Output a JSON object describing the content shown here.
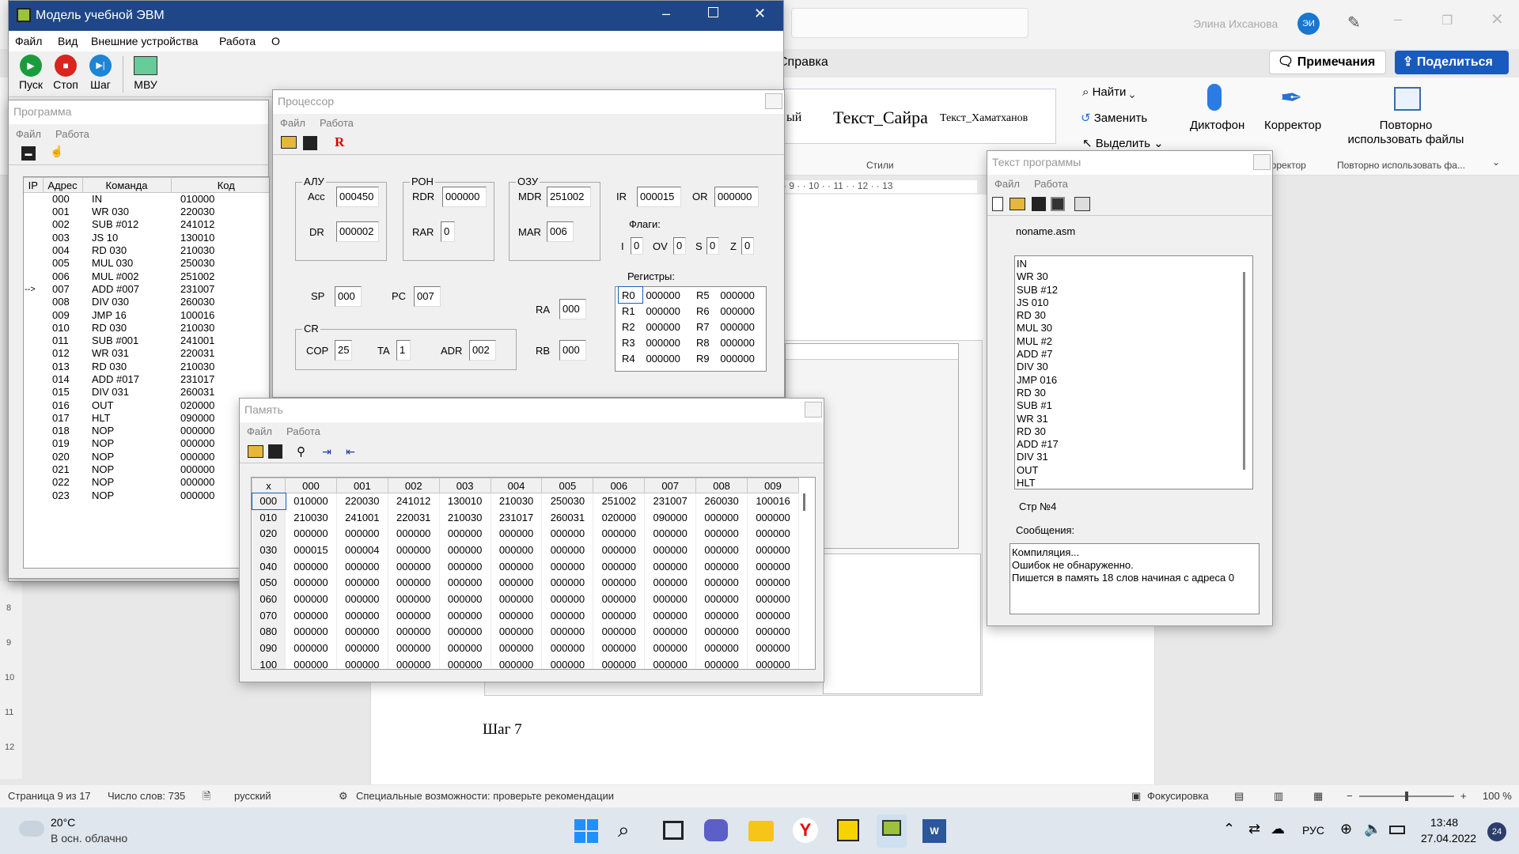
{
  "colors": {
    "accent": "#185abd",
    "titlebar": "#1f4788",
    "run": "#1a9c3e",
    "stop": "#d9251d",
    "step": "#1e84d4"
  },
  "word": {
    "search_placeholder": "",
    "user": "Элина Ихсанова",
    "user_initials": "ЭИ",
    "spravka": "Справка",
    "comments": "Примечания",
    "share": "Поделиться",
    "style1": "ый",
    "style2": "Текст_Сайра",
    "style3": "Текст_Хаматханов",
    "styles_label": "Стили",
    "find": "Найти",
    "replace": "Заменить",
    "select": "Выделить",
    "dictate": "Диктофон",
    "editor": "Корректор",
    "editor_group": "орректор",
    "reuse": "Повторно использовать файлы",
    "reuse_group": "Повторно использовать фа...",
    "ruler_h": "· 9 · · 10 · · 11 · · 12 · · 13",
    "ruler_v": [
      "8",
      "9",
      "10",
      "11",
      "12"
    ],
    "step_text": "Шаг 7",
    "status": {
      "page": "Страница 9 из 17",
      "words": "Число слов: 735",
      "lang": "русский",
      "access": "Специальные возможности: проверьте рекомендации",
      "focus": "Фокусировка",
      "zoom": "100 %"
    }
  },
  "taskbar": {
    "temp": "20°C",
    "weather": "В осн. облачно",
    "lang": "РУС",
    "time": "13:48",
    "date": "27.04.2022",
    "badge": "24"
  },
  "main": {
    "title": "Модель учебной ЭВМ",
    "menu": [
      "Файл",
      "Вид",
      "Внешние устройства",
      "Работа",
      "О"
    ],
    "run": "Пуск",
    "stop": "Стоп",
    "step": "Шаг",
    "mvu": "МВУ"
  },
  "program": {
    "title": "Программа",
    "menu": [
      "Файл",
      "Работа"
    ],
    "headers": [
      "IP",
      "Адрес",
      "Команда",
      "Код"
    ],
    "rows": [
      {
        "ip": "",
        "addr": "000",
        "cmd": "IN",
        "code": "010000"
      },
      {
        "ip": "",
        "addr": "001",
        "cmd": "WR 030",
        "code": "220030"
      },
      {
        "ip": "",
        "addr": "002",
        "cmd": "SUB #012",
        "code": "241012"
      },
      {
        "ip": "",
        "addr": "003",
        "cmd": "JS 10",
        "code": "130010"
      },
      {
        "ip": "",
        "addr": "004",
        "cmd": "RD 030",
        "code": "210030"
      },
      {
        "ip": "",
        "addr": "005",
        "cmd": "MUL 030",
        "code": "250030"
      },
      {
        "ip": "",
        "addr": "006",
        "cmd": "MUL #002",
        "code": "251002"
      },
      {
        "ip": "-->",
        "addr": "007",
        "cmd": "ADD #007",
        "code": "231007"
      },
      {
        "ip": "",
        "addr": "008",
        "cmd": "DIV 030",
        "code": "260030"
      },
      {
        "ip": "",
        "addr": "009",
        "cmd": "JMP 16",
        "code": "100016"
      },
      {
        "ip": "",
        "addr": "010",
        "cmd": "RD 030",
        "code": "210030"
      },
      {
        "ip": "",
        "addr": "011",
        "cmd": "SUB #001",
        "code": "241001"
      },
      {
        "ip": "",
        "addr": "012",
        "cmd": "WR 031",
        "code": "220031"
      },
      {
        "ip": "",
        "addr": "013",
        "cmd": "RD 030",
        "code": "210030"
      },
      {
        "ip": "",
        "addr": "014",
        "cmd": "ADD #017",
        "code": "231017"
      },
      {
        "ip": "",
        "addr": "015",
        "cmd": "DIV 031",
        "code": "260031"
      },
      {
        "ip": "",
        "addr": "016",
        "cmd": "OUT",
        "code": "020000"
      },
      {
        "ip": "",
        "addr": "017",
        "cmd": "HLT",
        "code": "090000"
      },
      {
        "ip": "",
        "addr": "018",
        "cmd": "NOP",
        "code": "000000"
      },
      {
        "ip": "",
        "addr": "019",
        "cmd": "NOP",
        "code": "000000"
      },
      {
        "ip": "",
        "addr": "020",
        "cmd": "NOP",
        "code": "000000"
      },
      {
        "ip": "",
        "addr": "021",
        "cmd": "NOP",
        "code": "000000"
      },
      {
        "ip": "",
        "addr": "022",
        "cmd": "NOP",
        "code": "000000"
      },
      {
        "ip": "",
        "addr": "023",
        "cmd": "NOP",
        "code": "000000"
      }
    ]
  },
  "cpu": {
    "title": "Процессор",
    "menu": [
      "Файл",
      "Работа"
    ],
    "r_icon": "R",
    "alu": "АЛУ",
    "acc_l": "Acc",
    "acc": "000450",
    "dr_l": "DR",
    "dr": "000002",
    "ron": "РОН",
    "rdr_l": "RDR",
    "rdr": "000000",
    "rar_l": "RAR",
    "rar": "0",
    "ozu": "ОЗУ",
    "mdr_l": "MDR",
    "mdr": "251002",
    "mar_l": "MAR",
    "mar": "006",
    "ir_l": "IR",
    "ir": "000015",
    "or_l": "OR",
    "or": "000000",
    "flags": "Флаги:",
    "fi_l": "I",
    "fi": "0",
    "fov_l": "OV",
    "fov": "0",
    "fs_l": "S",
    "fs": "0",
    "fz_l": "Z",
    "fz": "0",
    "regs_l": "Регистры:",
    "regs": [
      [
        "R0",
        "000000",
        "R5",
        "000000"
      ],
      [
        "R1",
        "000000",
        "R6",
        "000000"
      ],
      [
        "R2",
        "000000",
        "R7",
        "000000"
      ],
      [
        "R3",
        "000000",
        "R8",
        "000000"
      ],
      [
        "R4",
        "000000",
        "R9",
        "000000"
      ]
    ],
    "sp_l": "SP",
    "sp": "000",
    "pc_l": "PC",
    "pc": "007",
    "ra_l": "RA",
    "ra": "000",
    "rb_l": "RB",
    "rb": "000",
    "cr": "CR",
    "cop_l": "COP",
    "cop": "25",
    "ta_l": "TA",
    "ta": "1",
    "adr_l": "ADR",
    "adr": "002"
  },
  "memory": {
    "title": "Память",
    "menu": [
      "Файл",
      "Работа"
    ],
    "headers": [
      "x",
      "000",
      "001",
      "002",
      "003",
      "004",
      "005",
      "006",
      "007",
      "008",
      "009"
    ],
    "rows": [
      [
        "000",
        "010000",
        "220030",
        "241012",
        "130010",
        "210030",
        "250030",
        "251002",
        "231007",
        "260030",
        "100016"
      ],
      [
        "010",
        "210030",
        "241001",
        "220031",
        "210030",
        "231017",
        "260031",
        "020000",
        "090000",
        "000000",
        "000000"
      ],
      [
        "020",
        "000000",
        "000000",
        "000000",
        "000000",
        "000000",
        "000000",
        "000000",
        "000000",
        "000000",
        "000000"
      ],
      [
        "030",
        "000015",
        "000004",
        "000000",
        "000000",
        "000000",
        "000000",
        "000000",
        "000000",
        "000000",
        "000000"
      ],
      [
        "040",
        "000000",
        "000000",
        "000000",
        "000000",
        "000000",
        "000000",
        "000000",
        "000000",
        "000000",
        "000000"
      ],
      [
        "050",
        "000000",
        "000000",
        "000000",
        "000000",
        "000000",
        "000000",
        "000000",
        "000000",
        "000000",
        "000000"
      ],
      [
        "060",
        "000000",
        "000000",
        "000000",
        "000000",
        "000000",
        "000000",
        "000000",
        "000000",
        "000000",
        "000000"
      ],
      [
        "070",
        "000000",
        "000000",
        "000000",
        "000000",
        "000000",
        "000000",
        "000000",
        "000000",
        "000000",
        "000000"
      ],
      [
        "080",
        "000000",
        "000000",
        "000000",
        "000000",
        "000000",
        "000000",
        "000000",
        "000000",
        "000000",
        "000000"
      ],
      [
        "090",
        "000000",
        "000000",
        "000000",
        "000000",
        "000000",
        "000000",
        "000000",
        "000000",
        "000000",
        "000000"
      ],
      [
        "100",
        "000000",
        "000000",
        "000000",
        "000000",
        "000000",
        "000000",
        "000000",
        "000000",
        "000000",
        "000000"
      ]
    ]
  },
  "text": {
    "title": "Текст программы",
    "menu": [
      "Файл",
      "Работа"
    ],
    "filename": "noname.asm",
    "code": "IN\nWR 30\nSUB #12\nJS 010\nRD 30\nMUL 30\nMUL #2\nADD #7\nDIV 30\nJMP 016\nRD 30\nSUB #1\nWR 31\nRD 30\nADD #17\nDIV 31\nOUT\nHLT",
    "line": "Стр №4",
    "msgs_l": "Сообщения:",
    "msgs": "Компиляция...\nОшибок не обнаруженно.\nПишется в память 18 слов начиная с адреса 0"
  }
}
